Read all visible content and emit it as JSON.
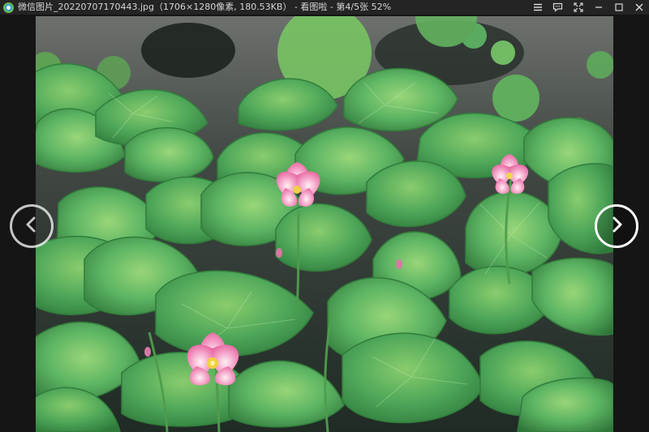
{
  "window": {
    "title": "微信图片_20220707170443.jpg（1706×1280像素, 180.53KB） - 看图啦 - 第4/5张 52%"
  },
  "icons": {
    "app": "viewer-app-icon",
    "menu": "menu-icon",
    "feedback": "chat-icon",
    "fullscreen": "fullscreen-icon",
    "minimize": "minimize-icon",
    "maximize": "maximize-icon",
    "close": "close-icon",
    "previous": "chevron-left-icon",
    "next": "chevron-right-icon"
  },
  "colors": {
    "background": "#141414",
    "titlebar": "#242424",
    "title_text": "#d6d6d6",
    "lotus_pink": "#f07aac",
    "leaf_green": "#5fb765"
  }
}
